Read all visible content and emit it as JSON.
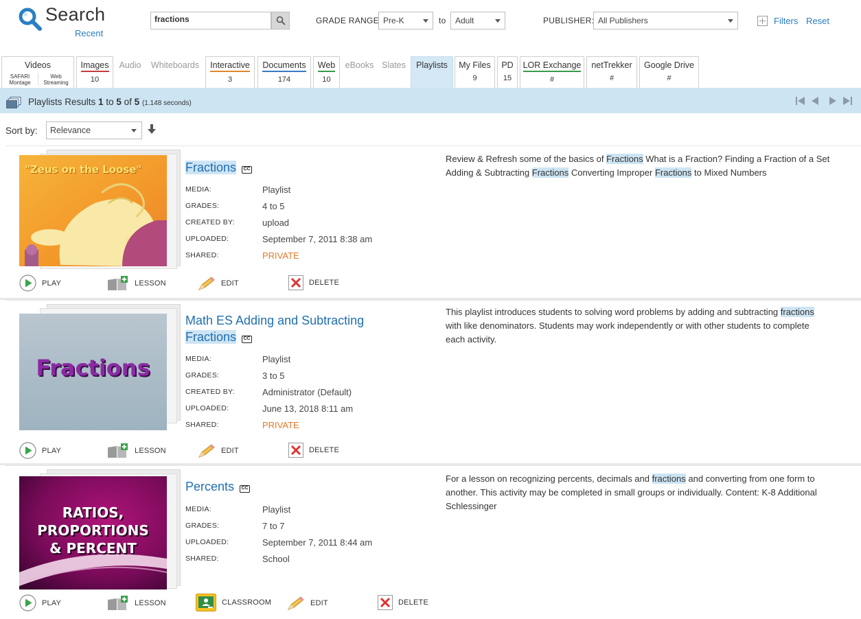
{
  "header": {
    "title": "Search",
    "recent_link": "Recent",
    "search_value": "fractions",
    "grade_range_label": "GRADE RANGE:",
    "grade_from": "Pre-K",
    "to_label": "to",
    "grade_to": "Adult",
    "publisher_label": "PUBLISHER:",
    "publisher_value": "All Publishers",
    "filters_link": "Filters",
    "reset_link": "Reset"
  },
  "tabs": [
    {
      "label": "Videos",
      "sub1": "SAFARI Montage",
      "sub2": "Web Streaming"
    },
    {
      "label": "Images",
      "count": "10"
    },
    {
      "label": "Audio"
    },
    {
      "label": "Whiteboards"
    },
    {
      "label": "Interactive",
      "count": "3"
    },
    {
      "label": "Documents",
      "count": "174"
    },
    {
      "label": "Web",
      "count": "10"
    },
    {
      "label": "eBooks"
    },
    {
      "label": "Slates"
    },
    {
      "label": "Playlists"
    },
    {
      "label": "My Files",
      "count": "9"
    },
    {
      "label": "PD",
      "count": "15"
    },
    {
      "label": "LOR Exchange",
      "count": "#"
    },
    {
      "label": "netTrekker",
      "count": "#"
    },
    {
      "label": "Google Drive",
      "count": "#"
    }
  ],
  "results_bar": {
    "prefix": "Playlists Results",
    "from": "1",
    "to_word": "to",
    "to": "5",
    "of_word": "of",
    "total": "5",
    "seconds": "(1.148 seconds)"
  },
  "sort": {
    "label": "Sort by:",
    "value": "Relevance"
  },
  "meta_labels": {
    "media": "MEDIA:",
    "grades": "GRADES:",
    "created_by": "CREATED BY:",
    "uploaded": "UPLOADED:",
    "shared": "SHARED:"
  },
  "actions": {
    "play": "PLAY",
    "lesson": "LESSON",
    "classroom": "CLASSROOM",
    "edit": "EDIT",
    "delete": "DELETE"
  },
  "cc_text": "CC",
  "results": [
    {
      "title": "Fractions",
      "thumb_text": "\"Zeus on the Loose\"",
      "media": "Playlist",
      "grades": "4 to 5",
      "created_by": "upload",
      "uploaded": "September 7, 2011 8:38 am",
      "shared": "PRIVATE",
      "desc_1": "Review & Refresh some of the basics of ",
      "desc_hl1": "Fractions",
      "desc_2": " What is a Fraction? Finding a Fraction of a Set Adding & Subtracting ",
      "desc_hl2": "Fractions",
      "desc_3": " Converting Improper ",
      "desc_hl3": "Fractions",
      "desc_4": " to Mixed Numbers"
    },
    {
      "title_part1": "Math ES Adding and Subtracting",
      "title_part2": "Fractions",
      "thumb_text": "Fractions",
      "media": "Playlist",
      "grades": "3 to 5",
      "created_by": "Administrator (Default)",
      "uploaded": "June 13, 2018 8:11 am",
      "shared": "PRIVATE",
      "desc_1": "This playlist introduces students to solving word problems by adding and subtracting ",
      "desc_hl1": "fractions",
      "desc_2": " with like denominators. Students may work independently or with other students to complete each activity."
    },
    {
      "title": "Percents",
      "thumb_line1": "Ratios,",
      "thumb_line2": "Proportions",
      "thumb_line3": "& Percent",
      "media": "Playlist",
      "grades": "7 to 7",
      "uploaded": "September 7, 2011 8:44 am",
      "shared": "School",
      "desc_1": "For a lesson on recognizing percents, decimals and ",
      "desc_hl1": "fractions",
      "desc_2": " and converting from one form to another. This activity may be completed in small groups or individually. Content: K-8 Additional Schlessinger"
    }
  ],
  "colors": {
    "link_blue": "#1f6fb2",
    "results_bar": "#cde4f3",
    "private_orange": "#e07a2a",
    "play_green": "#3aa34a",
    "delete_red": "#d33"
  }
}
